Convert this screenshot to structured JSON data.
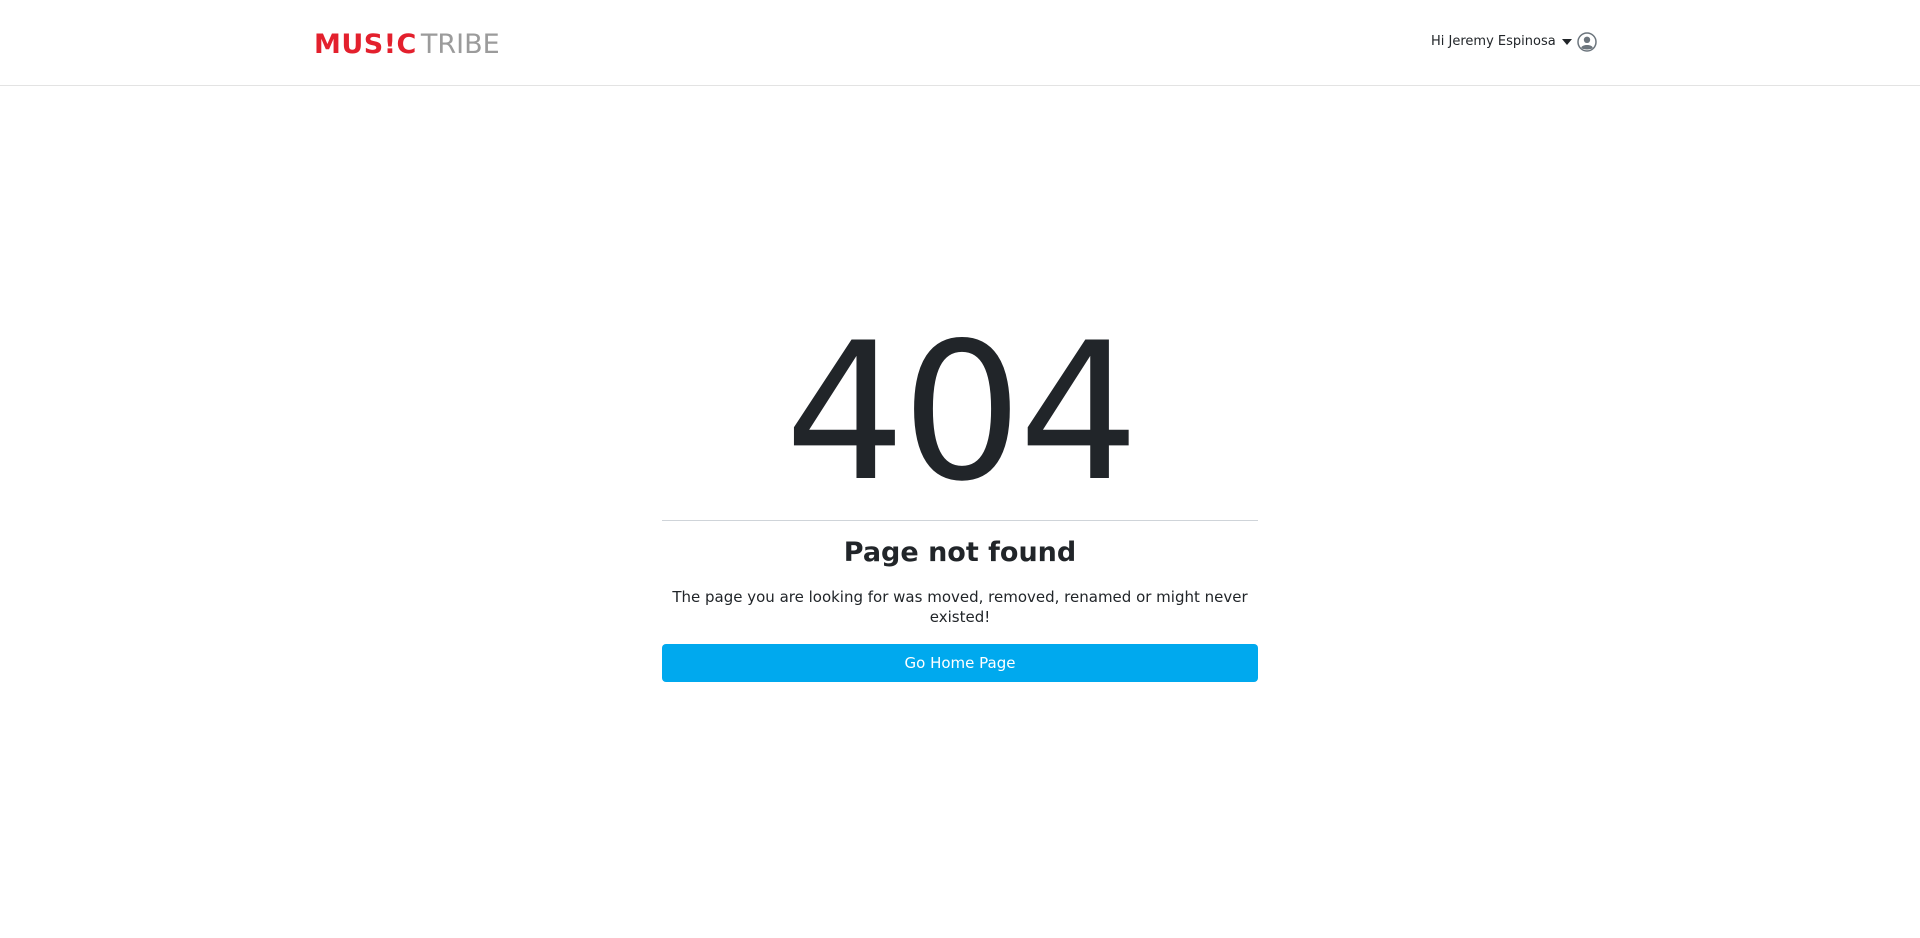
{
  "header": {
    "logo": {
      "part1": "MUS!C",
      "part2": "TRIBE"
    },
    "user": {
      "greeting": "Hi Jeremy Espinosa",
      "caret_icon": "caret-down-icon",
      "avatar_icon": "user-avatar-icon"
    }
  },
  "error": {
    "code": "404",
    "title": "Page not found",
    "message": "The page you are looking for was moved, removed, renamed or might never existed!",
    "button_label": "Go Home Page"
  },
  "colors": {
    "logo_red": "#e3202d",
    "logo_gray": "#9b9b9b",
    "button_blue": "#00a9ee",
    "text_dark": "#212529"
  }
}
